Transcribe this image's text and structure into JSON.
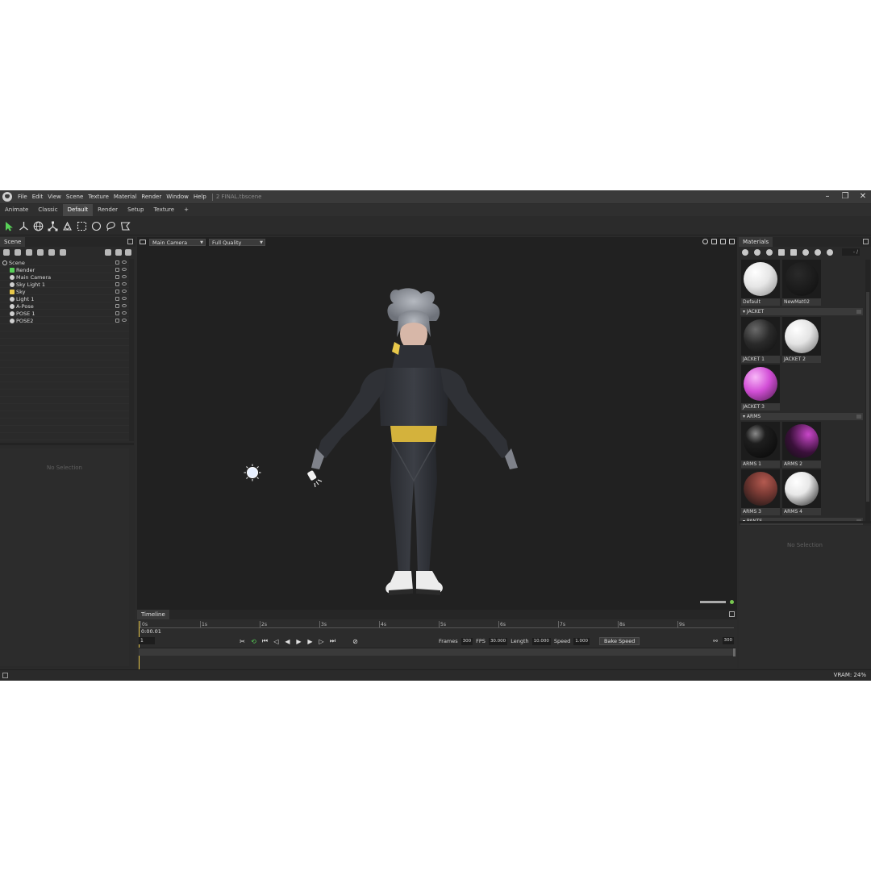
{
  "menu": {
    "items": [
      "File",
      "Edit",
      "View",
      "Scene",
      "Texture",
      "Material",
      "Render",
      "Window",
      "Help"
    ],
    "document_title": "2 FINAL.tbscene"
  },
  "workspace_tabs": [
    "Animate",
    "Classic",
    "Default",
    "Render",
    "Setup",
    "Texture",
    "+"
  ],
  "active_workspace": "Default",
  "scene": {
    "tab": "Scene",
    "tree": [
      {
        "label": "Scene",
        "icon": "ring-icon",
        "depth": 0
      },
      {
        "label": "Render",
        "icon": "render-icon",
        "depth": 1
      },
      {
        "label": "Main Camera",
        "icon": "camera-icon",
        "depth": 1
      },
      {
        "label": "Sky Light 1",
        "icon": "light-icon",
        "depth": 1
      },
      {
        "label": "Sky",
        "icon": "sky-icon",
        "depth": 1
      },
      {
        "label": "Light 1",
        "icon": "light-icon",
        "depth": 1
      },
      {
        "label": "A-Pose",
        "icon": "mesh-icon",
        "depth": 1
      },
      {
        "label": "POSE 1",
        "icon": "mesh-icon",
        "depth": 1
      },
      {
        "label": "POSE2",
        "icon": "mesh-icon",
        "depth": 1
      }
    ],
    "no_selection": "No Selection"
  },
  "viewport": {
    "camera": "Main Camera",
    "quality": "Full Quality"
  },
  "timeline": {
    "tab": "Timeline",
    "ticks": [
      "0s",
      "1s",
      "2s",
      "3s",
      "4s",
      "5s",
      "6s",
      "7s",
      "8s",
      "9s"
    ],
    "current_time": "0:00.01",
    "frame": "1",
    "frames_label": "Frames",
    "frames": "300",
    "fps_label": "FPS",
    "fps": "30.000",
    "length_label": "Length",
    "length": "10.000",
    "speed_label": "Speed",
    "speed": "1.000",
    "bake_label": "Bake Speed",
    "end_frame": "300"
  },
  "materials": {
    "tab": "Materials",
    "search": "- /",
    "top": [
      {
        "label": "Default",
        "color": "#e6e6e6",
        "style": "plain"
      },
      {
        "label": "NewMat02",
        "color": "#161616",
        "style": "dark"
      }
    ],
    "groups": [
      {
        "name": "JACKET",
        "items": [
          {
            "label": "JACKET 1",
            "color": "#2a2a2a",
            "style": "jacket-dark"
          },
          {
            "label": "JACKET 2",
            "color": "#e4e4e4",
            "style": "jacket-light"
          },
          {
            "label": "JACKET 3",
            "color": "#d24ed6",
            "style": "jacket-pink"
          }
        ]
      },
      {
        "name": "ARMS",
        "items": [
          {
            "label": "ARMS 1",
            "color": "#1e1e1e",
            "style": "glossy"
          },
          {
            "label": "ARMS 2",
            "color": "#c846c8",
            "style": "pink-dark"
          },
          {
            "label": "ARMS 3",
            "color": "#7a3a34",
            "style": "red-dark"
          },
          {
            "label": "ARMS 4",
            "color": "#e8e8e8",
            "style": "white-dark"
          }
        ]
      },
      {
        "name": "PANTS",
        "items": [
          {
            "label": "",
            "color": "#1e1e1e",
            "style": "pants-yellow"
          },
          {
            "label": "",
            "color": "#e0e0e0",
            "style": "jacket-light"
          },
          {
            "label": "",
            "color": "#1a1a1a",
            "style": "glossy"
          }
        ]
      }
    ],
    "no_selection": "No Selection"
  },
  "status": {
    "vram": "VRAM: 24%"
  },
  "colors": {
    "accent_yellow": "#e8c84a",
    "accent_green": "#58d058"
  }
}
